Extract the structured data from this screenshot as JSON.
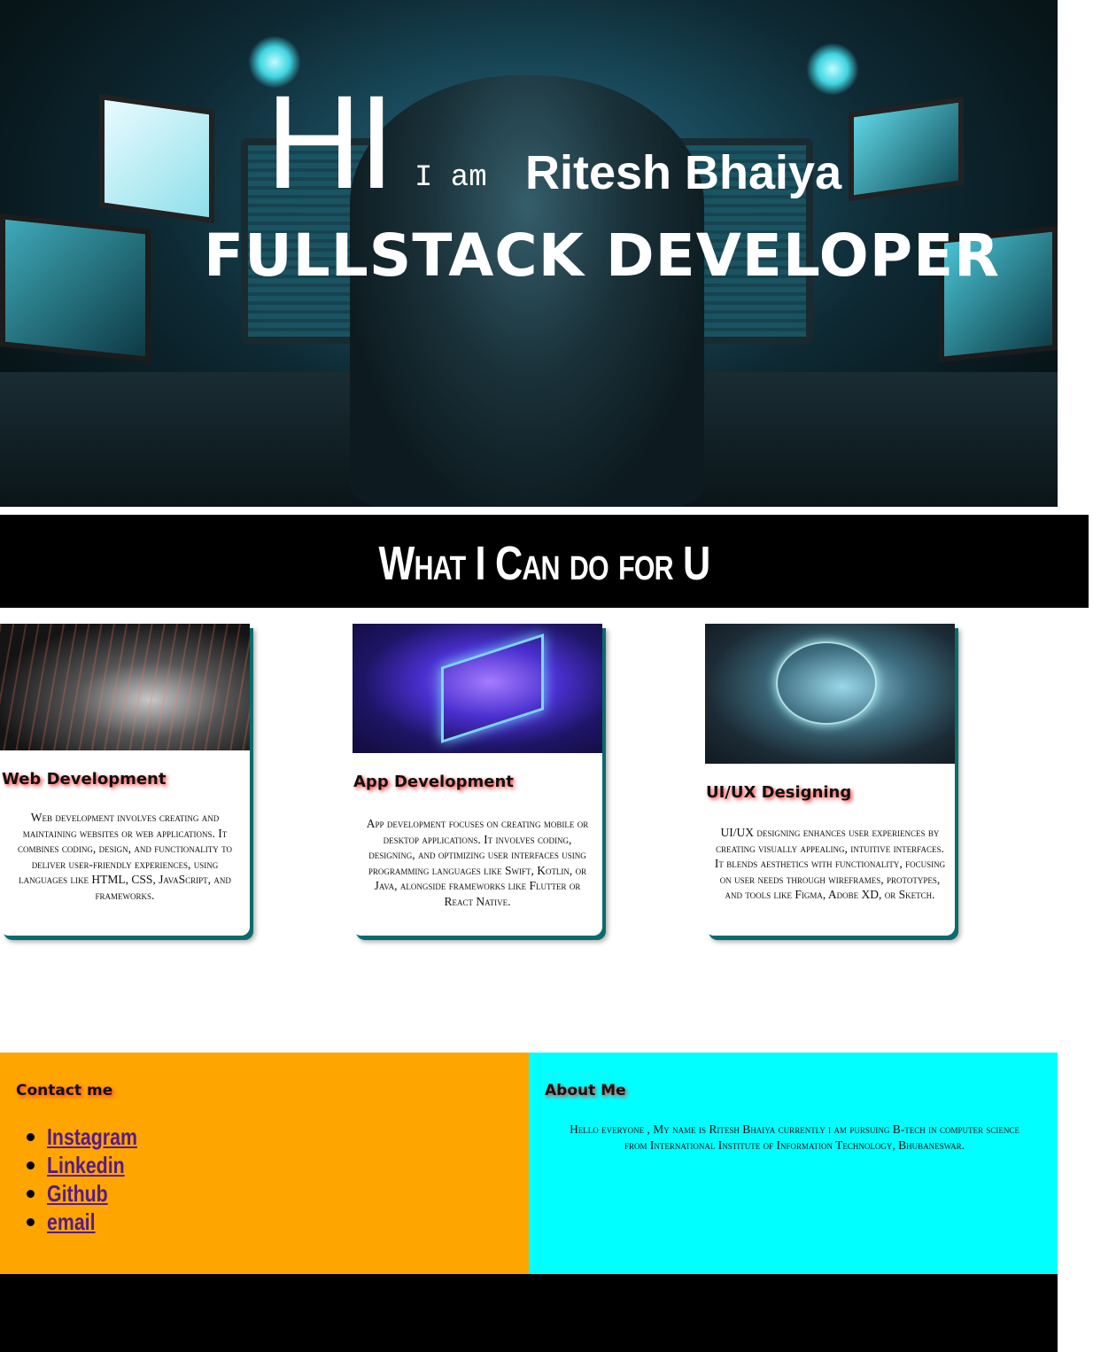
{
  "hero": {
    "greeting": "HI",
    "intro": "I am",
    "name": "Ritesh Bhaiya",
    "role": "FULLSTACK DEVELOPER"
  },
  "section": {
    "title": "What I Can do for U"
  },
  "cards": [
    {
      "title": "Web Development",
      "description": "Web development involves creating and maintaining websites or web applications. It combines coding, design, and functionality to deliver user-friendly experiences, using languages like HTML, CSS, JavaScript, and frameworks."
    },
    {
      "title": "App Development",
      "description": "App development focuses on creating mobile or desktop applications. It involves coding, designing, and optimizing user interfaces using programming languages like Swift, Kotlin, or Java, alongside frameworks like Flutter or React Native."
    },
    {
      "title": "UI/UX Designing",
      "description": "UI/UX designing enhances user experiences by creating visually appealing, intuitive interfaces. It blends aesthetics with functionality, focusing on user needs through wireframes, prototypes, and tools like Figma, Adobe XD, or Sketch."
    }
  ],
  "contact": {
    "heading": "Contact me",
    "links": [
      "Instagram",
      "Linkedin",
      "Github",
      "email"
    ]
  },
  "about": {
    "heading": "About Me",
    "text": "Hello everyone , My name is Ritesh Bhaiya currently i am pursuing B-tech in computer science from International Institute of Information Technology, Bhubaneswar."
  },
  "colors": {
    "contact_bg": "#ffa500",
    "about_bg": "#00ffff",
    "link": "#551a8b",
    "heading_shadow": "#ff3333",
    "card_shadow": "#0b6b6b"
  }
}
